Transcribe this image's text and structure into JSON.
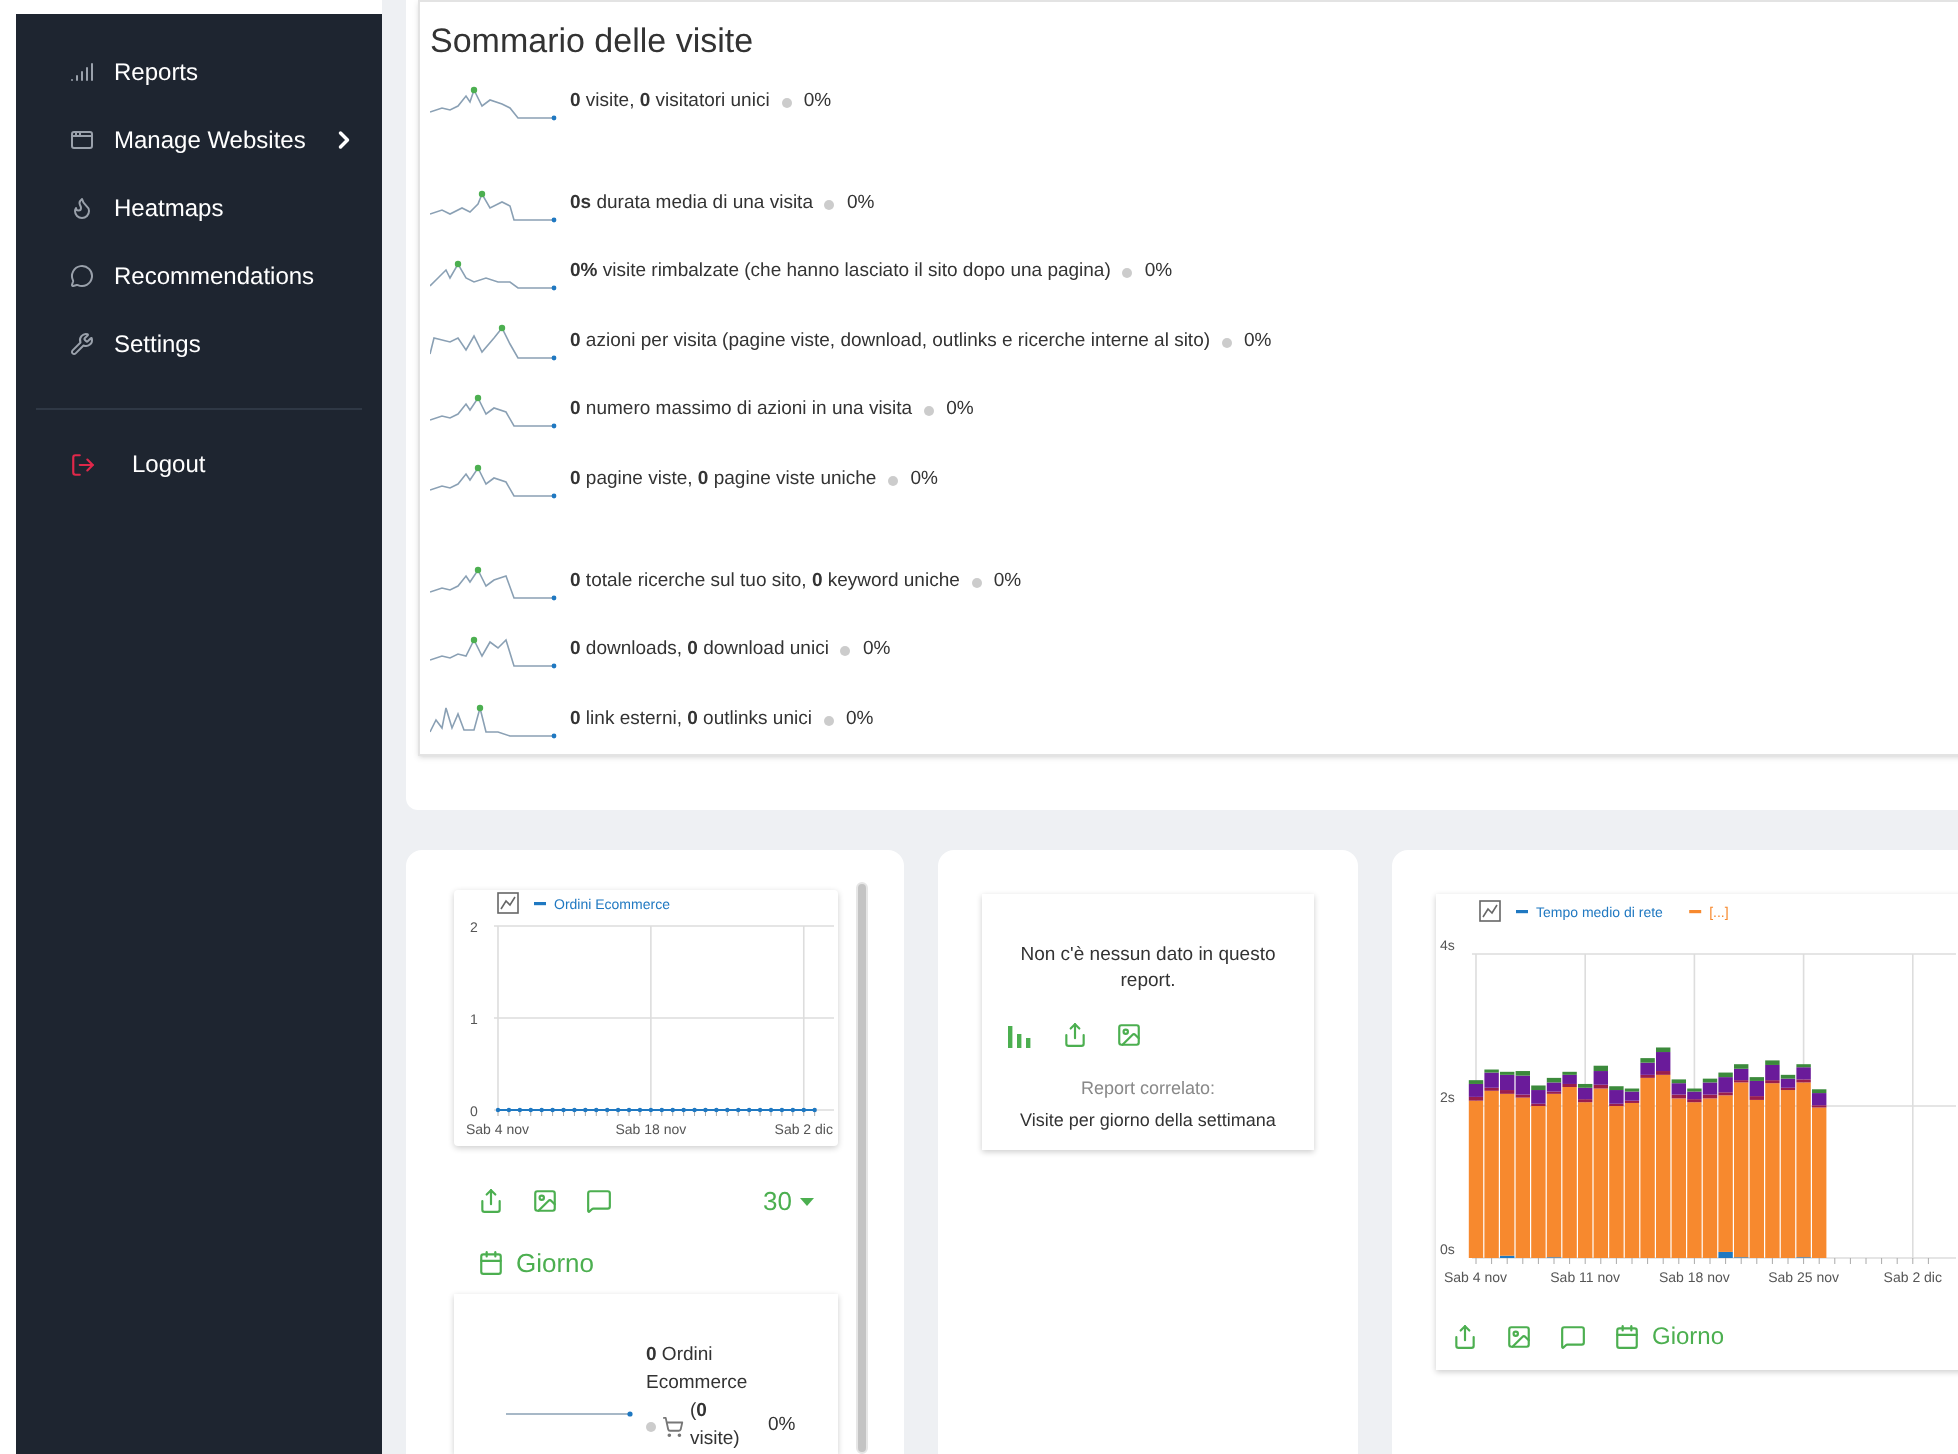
{
  "sidebar": {
    "items": [
      {
        "label": "Reports",
        "has_submenu": false
      },
      {
        "label": "Manage Websites",
        "has_submenu": true
      },
      {
        "label": "Heatmaps",
        "has_submenu": false
      },
      {
        "label": "Recommendations",
        "has_submenu": false
      },
      {
        "label": "Settings",
        "has_submenu": false
      }
    ],
    "logout": {
      "label": "Logout"
    }
  },
  "summary": {
    "title": "Sommario delle visite",
    "rows": [
      {
        "text": "**0** visite, **0** visitatori unici",
        "change": "0%"
      },
      {
        "text": "**0s** durata media di una visita",
        "change": "0%"
      },
      {
        "text": "**0%** visite rimbalzate (che hanno lasciato il sito dopo una pagina)",
        "change": "0%"
      },
      {
        "text": "**0** azioni per visita (pagine viste, download, outlinks e ricerche interne al sito)",
        "change": "0%"
      },
      {
        "text": "**0** numero massimo di azioni in una visita",
        "change": "0%"
      },
      {
        "text": "**0** pagine viste, **0** pagine viste uniche",
        "change": "0%"
      },
      {
        "text": "**0** totale ricerche sul tuo sito, **0** keyword uniche",
        "change": "0%"
      },
      {
        "text": "**0** downloads, **0** download unici",
        "change": "0%"
      },
      {
        "text": "**0** link esterni, **0** outlinks unici",
        "change": "0%"
      }
    ]
  },
  "ecommerce_widget": {
    "chart_data": {
      "type": "line",
      "grid": true,
      "legend": "top",
      "categories": [
        "Sab 4 nov",
        null,
        null,
        null,
        null,
        null,
        null,
        null,
        null,
        null,
        null,
        null,
        null,
        null,
        "Sab 18 nov",
        null,
        null,
        null,
        null,
        null,
        null,
        null,
        null,
        null,
        null,
        null,
        null,
        null,
        "Sab 2 dic",
        null
      ],
      "ylim": [
        0,
        2
      ],
      "yticks": [
        0,
        1,
        2
      ],
      "series": [
        {
          "name": "Ordini Ecommerce",
          "color": "#1f78c1",
          "values": [
            0,
            0,
            0,
            0,
            0,
            0,
            0,
            0,
            0,
            0,
            0,
            0,
            0,
            0,
            0,
            0,
            0,
            0,
            0,
            0,
            0,
            0,
            0,
            0,
            0,
            0,
            0,
            0,
            0,
            0
          ]
        }
      ]
    },
    "limit": "30",
    "period": "Giorno",
    "sparkline_row": {
      "text": "**0** Ordini Ecommerce",
      "change": "0%",
      "visits": "(**0** visite)"
    }
  },
  "empty_widget": {
    "message": "Non c'è nessun dato in questo report.",
    "related_label": "Report correlato:",
    "related_link": "Visite per giorno della settimana"
  },
  "performance_widget": {
    "chart_data": {
      "type": "bar",
      "stacked": true,
      "grid": true,
      "legend": "top",
      "categories": [
        "Sab 4 nov",
        null,
        null,
        null,
        null,
        null,
        null,
        "Sab 11 nov",
        null,
        null,
        null,
        null,
        null,
        null,
        "Sab 18 nov",
        null,
        null,
        null,
        null,
        null,
        null,
        "Sab 25 nov",
        null,
        null,
        null,
        null,
        null,
        null,
        "Sab 2 dic",
        null
      ],
      "ylim": [
        0,
        4
      ],
      "yticks": [
        {
          "value": 0,
          "label": "0s"
        },
        {
          "value": 2,
          "label": "2s"
        },
        {
          "value": 4,
          "label": "4s"
        }
      ],
      "series": [
        {
          "name": "Tempo medio di rete",
          "color": "#1f78c1",
          "values": [
            0,
            0,
            0.03,
            0,
            0,
            0.01,
            0,
            0,
            0,
            0,
            0,
            0,
            0,
            0,
            0,
            0,
            0.08,
            0.01,
            0,
            0,
            0,
            0.01,
            0,
            null,
            null,
            null,
            null,
            null,
            null,
            null
          ]
        },
        {
          "name": "[...]",
          "color": "#f7892e",
          "values": [
            2.07,
            2.2,
            2.13,
            2.11,
            2.0,
            2.15,
            2.25,
            2.05,
            2.23,
            2.0,
            2.04,
            2.37,
            2.41,
            2.1,
            2.05,
            2.1,
            2.06,
            2.3,
            2.08,
            2.3,
            2.21,
            2.3,
            1.98,
            null,
            null,
            null,
            null,
            null,
            null,
            null
          ]
        },
        {
          "color": "#9b1d4c",
          "values": [
            0.05,
            0.04,
            0.05,
            0.04,
            0.03,
            0.03,
            0.04,
            0.04,
            0.05,
            0.03,
            0.03,
            0.04,
            0.05,
            0.05,
            0.04,
            0.05,
            0.04,
            0.03,
            0.05,
            0.04,
            0.03,
            0.04,
            0.03,
            null,
            null,
            null,
            null,
            null,
            null,
            null
          ]
        },
        {
          "color": "#6a1b9a",
          "values": [
            0.17,
            0.2,
            0.2,
            0.25,
            0.18,
            0.12,
            0.12,
            0.15,
            0.18,
            0.18,
            0.12,
            0.16,
            0.25,
            0.15,
            0.1,
            0.16,
            0.2,
            0.15,
            0.2,
            0.2,
            0.12,
            0.16,
            0.16,
            null,
            null,
            null,
            null,
            null,
            null,
            null
          ]
        },
        {
          "color": "#3c8a3c",
          "values": [
            0.05,
            0.04,
            0.04,
            0.06,
            0.06,
            0.06,
            0.04,
            0.05,
            0.07,
            0.05,
            0.04,
            0.06,
            0.06,
            0.05,
            0.04,
            0.05,
            0.06,
            0.06,
            0.05,
            0.06,
            0.05,
            0.04,
            0.05,
            null,
            null,
            null,
            null,
            null,
            null,
            null
          ]
        }
      ]
    },
    "period": "Giorno"
  }
}
